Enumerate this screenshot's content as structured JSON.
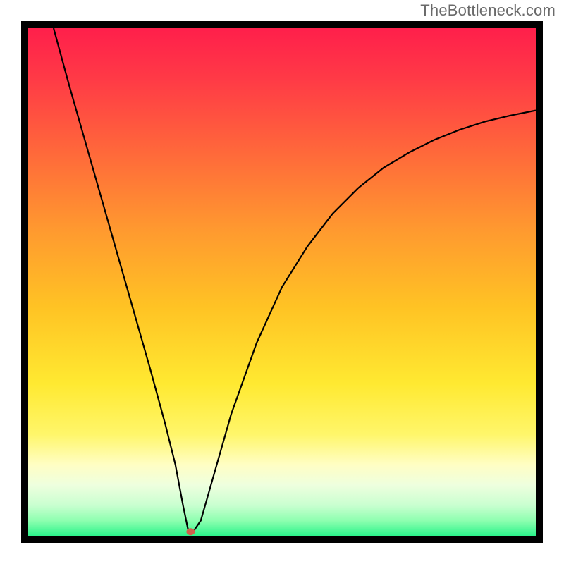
{
  "watermark": "TheBottleneck.com",
  "chart_data": {
    "type": "line",
    "title": "",
    "xlabel": "",
    "ylabel": "",
    "xlim": [
      0,
      100
    ],
    "ylim": [
      0,
      100
    ],
    "grid": false,
    "legend": false,
    "background_gradient": {
      "stops": [
        {
          "offset": 0,
          "color": "#ff1f4b"
        },
        {
          "offset": 0.1,
          "color": "#ff3a46"
        },
        {
          "offset": 0.25,
          "color": "#ff6a3a"
        },
        {
          "offset": 0.4,
          "color": "#ff9a2f"
        },
        {
          "offset": 0.55,
          "color": "#ffc324"
        },
        {
          "offset": 0.7,
          "color": "#ffe931"
        },
        {
          "offset": 0.8,
          "color": "#fff66a"
        },
        {
          "offset": 0.86,
          "color": "#fffec4"
        },
        {
          "offset": 0.9,
          "color": "#eeffde"
        },
        {
          "offset": 0.94,
          "color": "#c9ffd0"
        },
        {
          "offset": 0.97,
          "color": "#8effb0"
        },
        {
          "offset": 1.0,
          "color": "#2cf48b"
        }
      ]
    },
    "series": [
      {
        "name": "bottleneck-curve",
        "color": "#000000",
        "x": [
          5,
          8,
          12,
          16,
          20,
          24,
          27,
          29,
          30.5,
          31.5,
          32.5,
          34,
          36,
          40,
          45,
          50,
          55,
          60,
          65,
          70,
          75,
          80,
          85,
          90,
          95,
          100
        ],
        "y": [
          100,
          89,
          75,
          61,
          47,
          33,
          22,
          14,
          6,
          1.2,
          0.8,
          3,
          10,
          24,
          38,
          49,
          57,
          63.5,
          68.5,
          72.5,
          75.5,
          78,
          80,
          81.6,
          82.8,
          83.8
        ]
      }
    ],
    "annotations": [
      {
        "name": "minimum-marker",
        "shape": "ellipse",
        "x": 32,
        "y": 0.8,
        "color": "#d1604c"
      }
    ]
  }
}
